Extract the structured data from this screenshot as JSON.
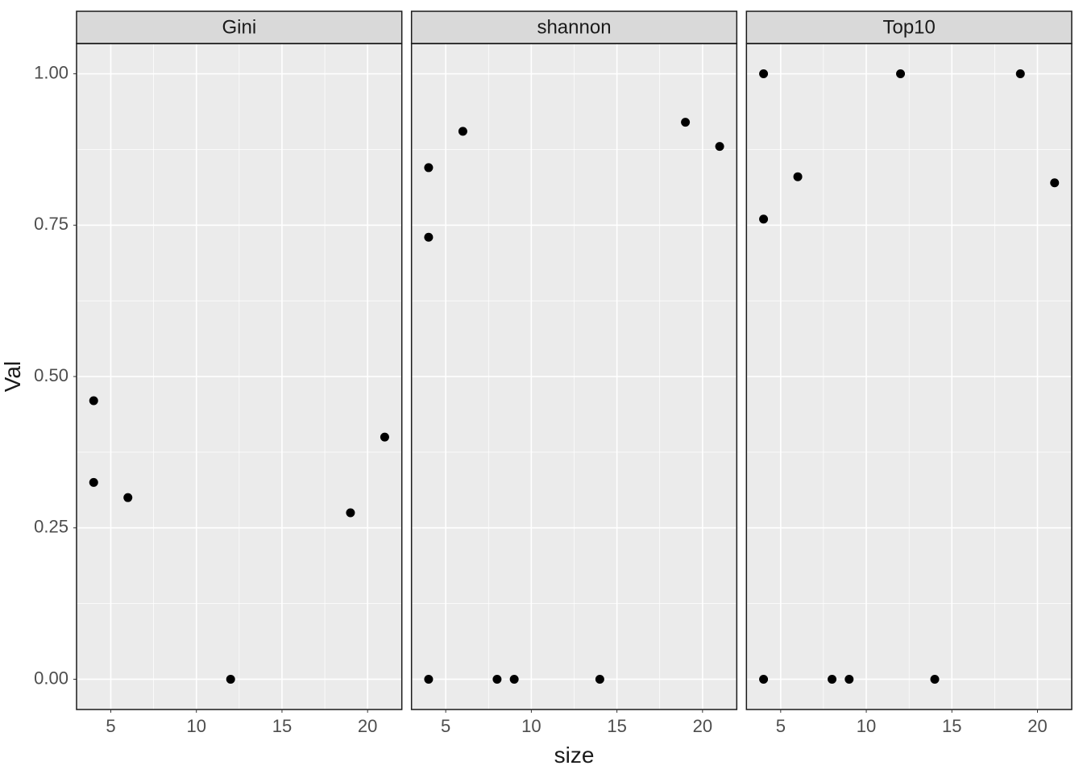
{
  "chart_data": {
    "type": "scatter",
    "xlabel": "size",
    "ylabel": "Val",
    "xlim": [
      3,
      22
    ],
    "ylim": [
      -0.05,
      1.05
    ],
    "x_ticks": [
      5,
      10,
      15,
      20
    ],
    "y_ticks": [
      0.0,
      0.25,
      0.5,
      0.75,
      1.0
    ],
    "y_tick_labels": [
      "0.00",
      "0.25",
      "0.50",
      "0.75",
      "1.00"
    ],
    "facets": [
      {
        "label": "Gini",
        "points": [
          {
            "x": 4,
            "y": 0.46
          },
          {
            "x": 4,
            "y": 0.325
          },
          {
            "x": 6,
            "y": 0.3
          },
          {
            "x": 12,
            "y": 0.0
          },
          {
            "x": 19,
            "y": 0.275
          },
          {
            "x": 21,
            "y": 0.4
          }
        ]
      },
      {
        "label": "shannon",
        "points": [
          {
            "x": 4,
            "y": 0.845
          },
          {
            "x": 4,
            "y": 0.73
          },
          {
            "x": 4,
            "y": 0.0
          },
          {
            "x": 6,
            "y": 0.905
          },
          {
            "x": 8,
            "y": 0.0
          },
          {
            "x": 9,
            "y": 0.0
          },
          {
            "x": 14,
            "y": 0.0
          },
          {
            "x": 19,
            "y": 0.92
          },
          {
            "x": 21,
            "y": 0.88
          }
        ]
      },
      {
        "label": "Top10",
        "points": [
          {
            "x": 4,
            "y": 1.0
          },
          {
            "x": 4,
            "y": 0.76
          },
          {
            "x": 4,
            "y": 0.0
          },
          {
            "x": 6,
            "y": 0.83
          },
          {
            "x": 8,
            "y": 0.0
          },
          {
            "x": 9,
            "y": 0.0
          },
          {
            "x": 12,
            "y": 1.0
          },
          {
            "x": 14,
            "y": 0.0
          },
          {
            "x": 19,
            "y": 1.0
          },
          {
            "x": 21,
            "y": 0.82
          }
        ]
      }
    ]
  }
}
